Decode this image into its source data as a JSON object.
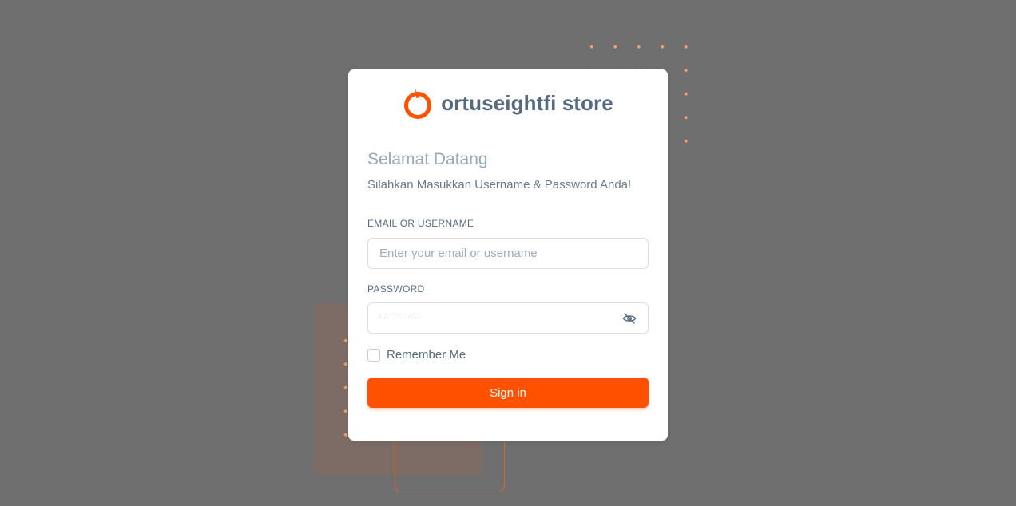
{
  "brand": {
    "name": "ortuseightfi store",
    "logo_icon": "orange-ring-logo-icon",
    "accent_color": "#ff5100"
  },
  "login": {
    "welcome_title": "Selamat Datang",
    "subtitle": "Silahkan Masukkan Username & Password Anda!",
    "email_label": "EMAIL OR USERNAME",
    "email_placeholder": "Enter your email or username",
    "email_value": "",
    "password_label": "PASSWORD",
    "password_value": "············",
    "password_toggle_icon": "eye-off-icon",
    "remember_label": "Remember Me",
    "remember_checked": false,
    "signin_label": "Sign in"
  }
}
